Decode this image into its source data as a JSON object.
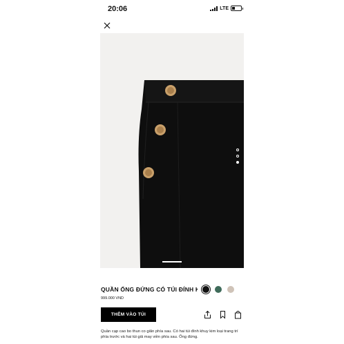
{
  "status_bar": {
    "time": "20:06",
    "network": "LTE"
  },
  "product": {
    "title": "QUẦN ỐNG ĐỨNG CÓ TÚI ĐÍNH K...",
    "price": "999.000 VND",
    "add_to_cart_label": "THÊM VÀO TÚI",
    "description": "Quần cạp cao bo thun co giãn phía sau. Có hai túi đính khuy kim loại trang trí phía trước và hai túi giả may viền phía sau. Ống đứng.",
    "image_alt": "Black high-waist trousers with gold buttons",
    "carousel": {
      "total": 3,
      "active_index": 2
    },
    "colors": [
      {
        "name": "black",
        "hex": "#111111",
        "selected": true
      },
      {
        "name": "green",
        "hex": "#3f6b5a",
        "selected": false
      },
      {
        "name": "beige",
        "hex": "#cfc3b8",
        "selected": false
      }
    ]
  },
  "icons": {
    "close": "close-icon",
    "share": "share-icon",
    "bookmark": "bookmark-icon",
    "bag": "shopping-bag-icon"
  },
  "colors": {
    "button_bg": "#000000",
    "button_text": "#ffffff",
    "image_bg": "#f2f1ef",
    "garment": "#0e0e0e",
    "button_gold": "#c9a06a"
  }
}
